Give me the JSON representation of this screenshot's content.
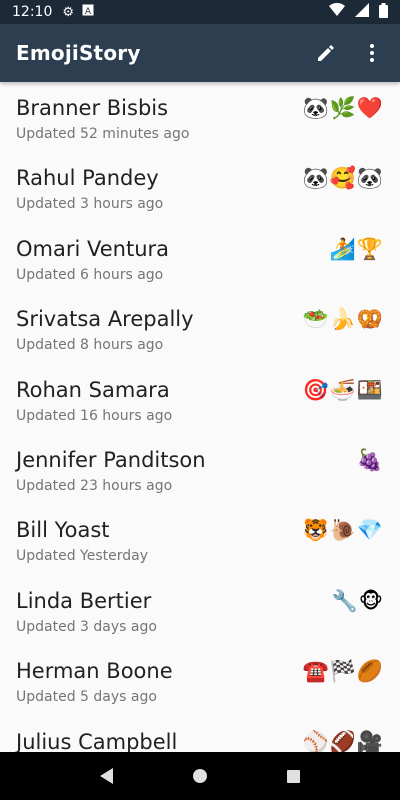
{
  "status_bar": {
    "time": "12:10",
    "icons": [
      "gear-icon",
      "a-box-icon",
      "wifi-icon",
      "signal-icon",
      "battery-icon"
    ]
  },
  "app_bar": {
    "title": "EmojiStory",
    "background": "#2c3e50",
    "actions": [
      "pencil-icon",
      "overflow-menu-icon"
    ]
  },
  "list": [
    {
      "name": "Branner Bisbis",
      "updated": "Updated 52 minutes ago",
      "emojis": "🐼🌿❤️"
    },
    {
      "name": "Rahul Pandey",
      "updated": "Updated 3 hours ago",
      "emojis": "🐼🥰🐼"
    },
    {
      "name": "Omari Ventura",
      "updated": "Updated 6 hours ago",
      "emojis": "🏄🏆"
    },
    {
      "name": "Srivatsa Arepally",
      "updated": "Updated 8 hours ago",
      "emojis": "🥗🍌🥨"
    },
    {
      "name": "Rohan Samara",
      "updated": "Updated 16 hours ago",
      "emojis": "🎯🍜🍱"
    },
    {
      "name": "Jennifer Panditson",
      "updated": "Updated 23 hours ago",
      "emojis": "🍇"
    },
    {
      "name": "Bill Yoast",
      "updated": "Updated Yesterday",
      "emojis": "🐯🐌💎"
    },
    {
      "name": "Linda Bertier",
      "updated": "Updated 3 days ago",
      "emojis": "🔧🐵"
    },
    {
      "name": "Herman Boone",
      "updated": "Updated 5 days ago",
      "emojis": "☎️🏁🏉"
    },
    {
      "name": "Julius Campbell",
      "updated": "",
      "emojis": "⚾🏈🎥"
    }
  ],
  "nav_bar": {
    "buttons": [
      "back-icon",
      "home-icon",
      "recents-icon"
    ]
  }
}
